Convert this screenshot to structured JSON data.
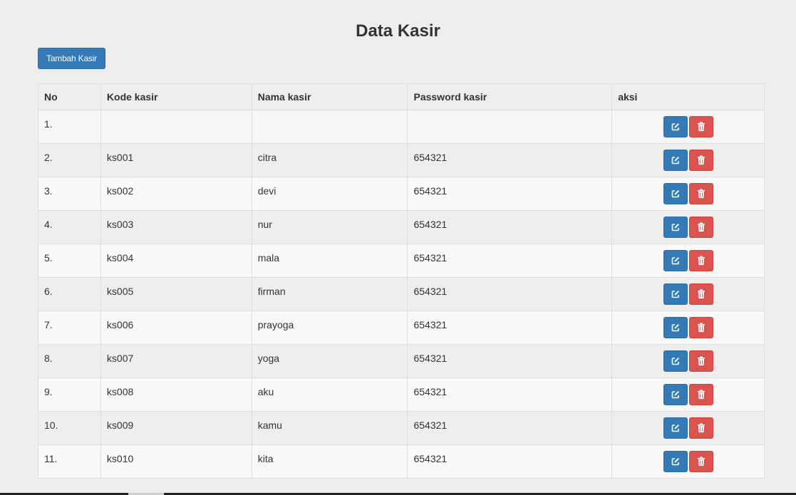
{
  "page": {
    "title": "Data Kasir",
    "add_button_label": "Tambah Kasir"
  },
  "table": {
    "headers": [
      "No",
      "Kode kasir",
      "Nama kasir",
      "Password kasir",
      "aksi"
    ],
    "rows": [
      {
        "no": "1.",
        "kode": "",
        "nama": "",
        "password": ""
      },
      {
        "no": "2.",
        "kode": "ks001",
        "nama": "citra",
        "password": "654321"
      },
      {
        "no": "3.",
        "kode": "ks002",
        "nama": "devi",
        "password": "654321"
      },
      {
        "no": "4.",
        "kode": "ks003",
        "nama": "nur",
        "password": "654321"
      },
      {
        "no": "5.",
        "kode": "ks004",
        "nama": "mala",
        "password": "654321"
      },
      {
        "no": "6.",
        "kode": "ks005",
        "nama": "firman",
        "password": "654321"
      },
      {
        "no": "7.",
        "kode": "ks006",
        "nama": "prayoga",
        "password": "654321"
      },
      {
        "no": "8.",
        "kode": "ks007",
        "nama": "yoga",
        "password": "654321"
      },
      {
        "no": "9.",
        "kode": "ks008",
        "nama": "aku",
        "password": "654321"
      },
      {
        "no": "10.",
        "kode": "ks009",
        "nama": "kamu",
        "password": "654321"
      },
      {
        "no": "11.",
        "kode": "ks010",
        "nama": "kita",
        "password": "654321"
      }
    ],
    "row_actions": [
      {
        "icon": "edit-icon",
        "color": "#337ab7"
      },
      {
        "icon": "trash-icon",
        "color": "#d9534f"
      }
    ]
  },
  "colors": {
    "primary": "#337ab7",
    "danger": "#d9534f",
    "background": "#eeeeee"
  }
}
